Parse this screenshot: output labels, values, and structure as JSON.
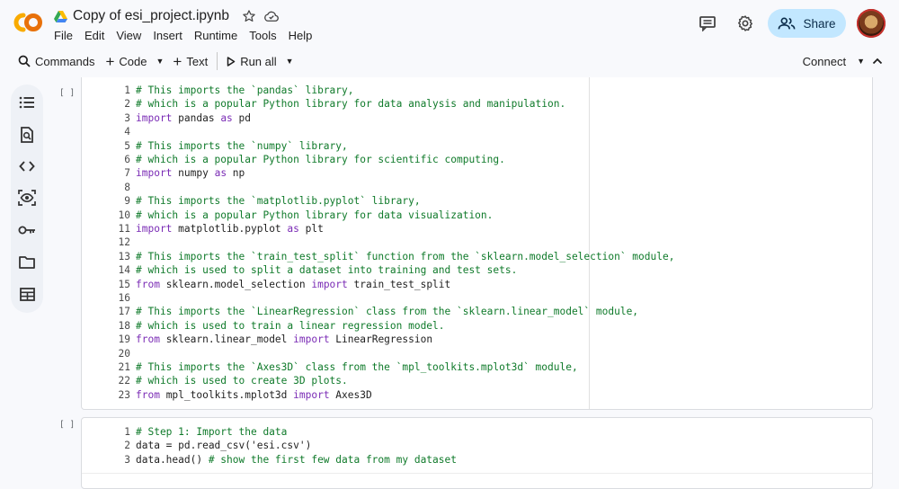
{
  "app": {
    "logo_text": "CO",
    "title": "Copy of esi_project.ipynb",
    "menu": [
      "File",
      "Edit",
      "View",
      "Insert",
      "Runtime",
      "Tools",
      "Help"
    ],
    "share_label": "Share"
  },
  "icons": {
    "drive": "google-drive-icon",
    "star": "star-icon",
    "cloud": "cloud-check-icon",
    "comments": "comment-icon",
    "settings": "gear-icon"
  },
  "toolbar": {
    "commands": "Commands",
    "code": "Code",
    "text": "Text",
    "run_all": "Run all",
    "connect": "Connect"
  },
  "sidebar": [
    "toc-icon",
    "find-icon",
    "code-snippets-icon",
    "variables-icon",
    "secrets-key-icon",
    "folder-icon",
    "data-table-icon"
  ],
  "colors": {
    "comment": "#0f7a2a",
    "keyword": "#7a2bb5",
    "share_bg": "#c2e7ff",
    "logo_orange": "#f9ab00",
    "logo_dark_orange": "#e8710a"
  },
  "cells": [
    {
      "run_marker": "[ ]",
      "lines": [
        [
          {
            "t": "# This imports the `pandas` library,",
            "c": "comment"
          }
        ],
        [
          {
            "t": "# which is a popular Python library for data analysis and manipulation.",
            "c": "comment"
          }
        ],
        [
          {
            "t": "import",
            "c": "kw"
          },
          {
            "t": " pandas ",
            "c": ""
          },
          {
            "t": "as",
            "c": "kw"
          },
          {
            "t": " pd",
            "c": ""
          }
        ],
        [],
        [
          {
            "t": "# This imports the `numpy` library,",
            "c": "comment"
          }
        ],
        [
          {
            "t": "# which is a popular Python library for scientific computing.",
            "c": "comment"
          }
        ],
        [
          {
            "t": "import",
            "c": "kw"
          },
          {
            "t": " numpy ",
            "c": ""
          },
          {
            "t": "as",
            "c": "kw"
          },
          {
            "t": " np",
            "c": ""
          }
        ],
        [],
        [
          {
            "t": "# This imports the `matplotlib.pyplot` library,",
            "c": "comment"
          }
        ],
        [
          {
            "t": "# which is a popular Python library for data visualization.",
            "c": "comment"
          }
        ],
        [
          {
            "t": "import",
            "c": "kw"
          },
          {
            "t": " matplotlib.pyplot ",
            "c": ""
          },
          {
            "t": "as",
            "c": "kw"
          },
          {
            "t": " plt",
            "c": ""
          }
        ],
        [],
        [
          {
            "t": "# This imports the `train_test_split` function from the `sklearn.model_selection` module,",
            "c": "comment"
          }
        ],
        [
          {
            "t": "# which is used to split a dataset into training and test sets.",
            "c": "comment"
          }
        ],
        [
          {
            "t": "from",
            "c": "kw"
          },
          {
            "t": " sklearn.model_selection ",
            "c": ""
          },
          {
            "t": "import",
            "c": "kw"
          },
          {
            "t": " train_test_split",
            "c": ""
          }
        ],
        [],
        [
          {
            "t": "# This imports the `LinearRegression` class from the `sklearn.linear_model` module,",
            "c": "comment"
          }
        ],
        [
          {
            "t": "# which is used to train a linear regression model.",
            "c": "comment"
          }
        ],
        [
          {
            "t": "from",
            "c": "kw"
          },
          {
            "t": " sklearn.linear_model ",
            "c": ""
          },
          {
            "t": "import",
            "c": "kw"
          },
          {
            "t": " LinearRegression",
            "c": ""
          }
        ],
        [],
        [
          {
            "t": "# This imports the `Axes3D` class from the `mpl_toolkits.mplot3d` module,",
            "c": "comment"
          }
        ],
        [
          {
            "t": "# which is used to create 3D plots.",
            "c": "comment"
          }
        ],
        [
          {
            "t": "from",
            "c": "kw"
          },
          {
            "t": " mpl_toolkits.mplot3d ",
            "c": ""
          },
          {
            "t": "import",
            "c": "kw"
          },
          {
            "t": " Axes3D",
            "c": ""
          }
        ]
      ]
    },
    {
      "run_marker": "[ ]",
      "lines": [
        [
          {
            "t": "# Step 1: Import the data",
            "c": "comment"
          }
        ],
        [
          {
            "t": "data = pd.read_csv('esi.csv')",
            "c": ""
          }
        ],
        [
          {
            "t": "data.head() ",
            "c": ""
          },
          {
            "t": "# show the first few data from my dataset",
            "c": "comment"
          }
        ]
      ]
    }
  ]
}
